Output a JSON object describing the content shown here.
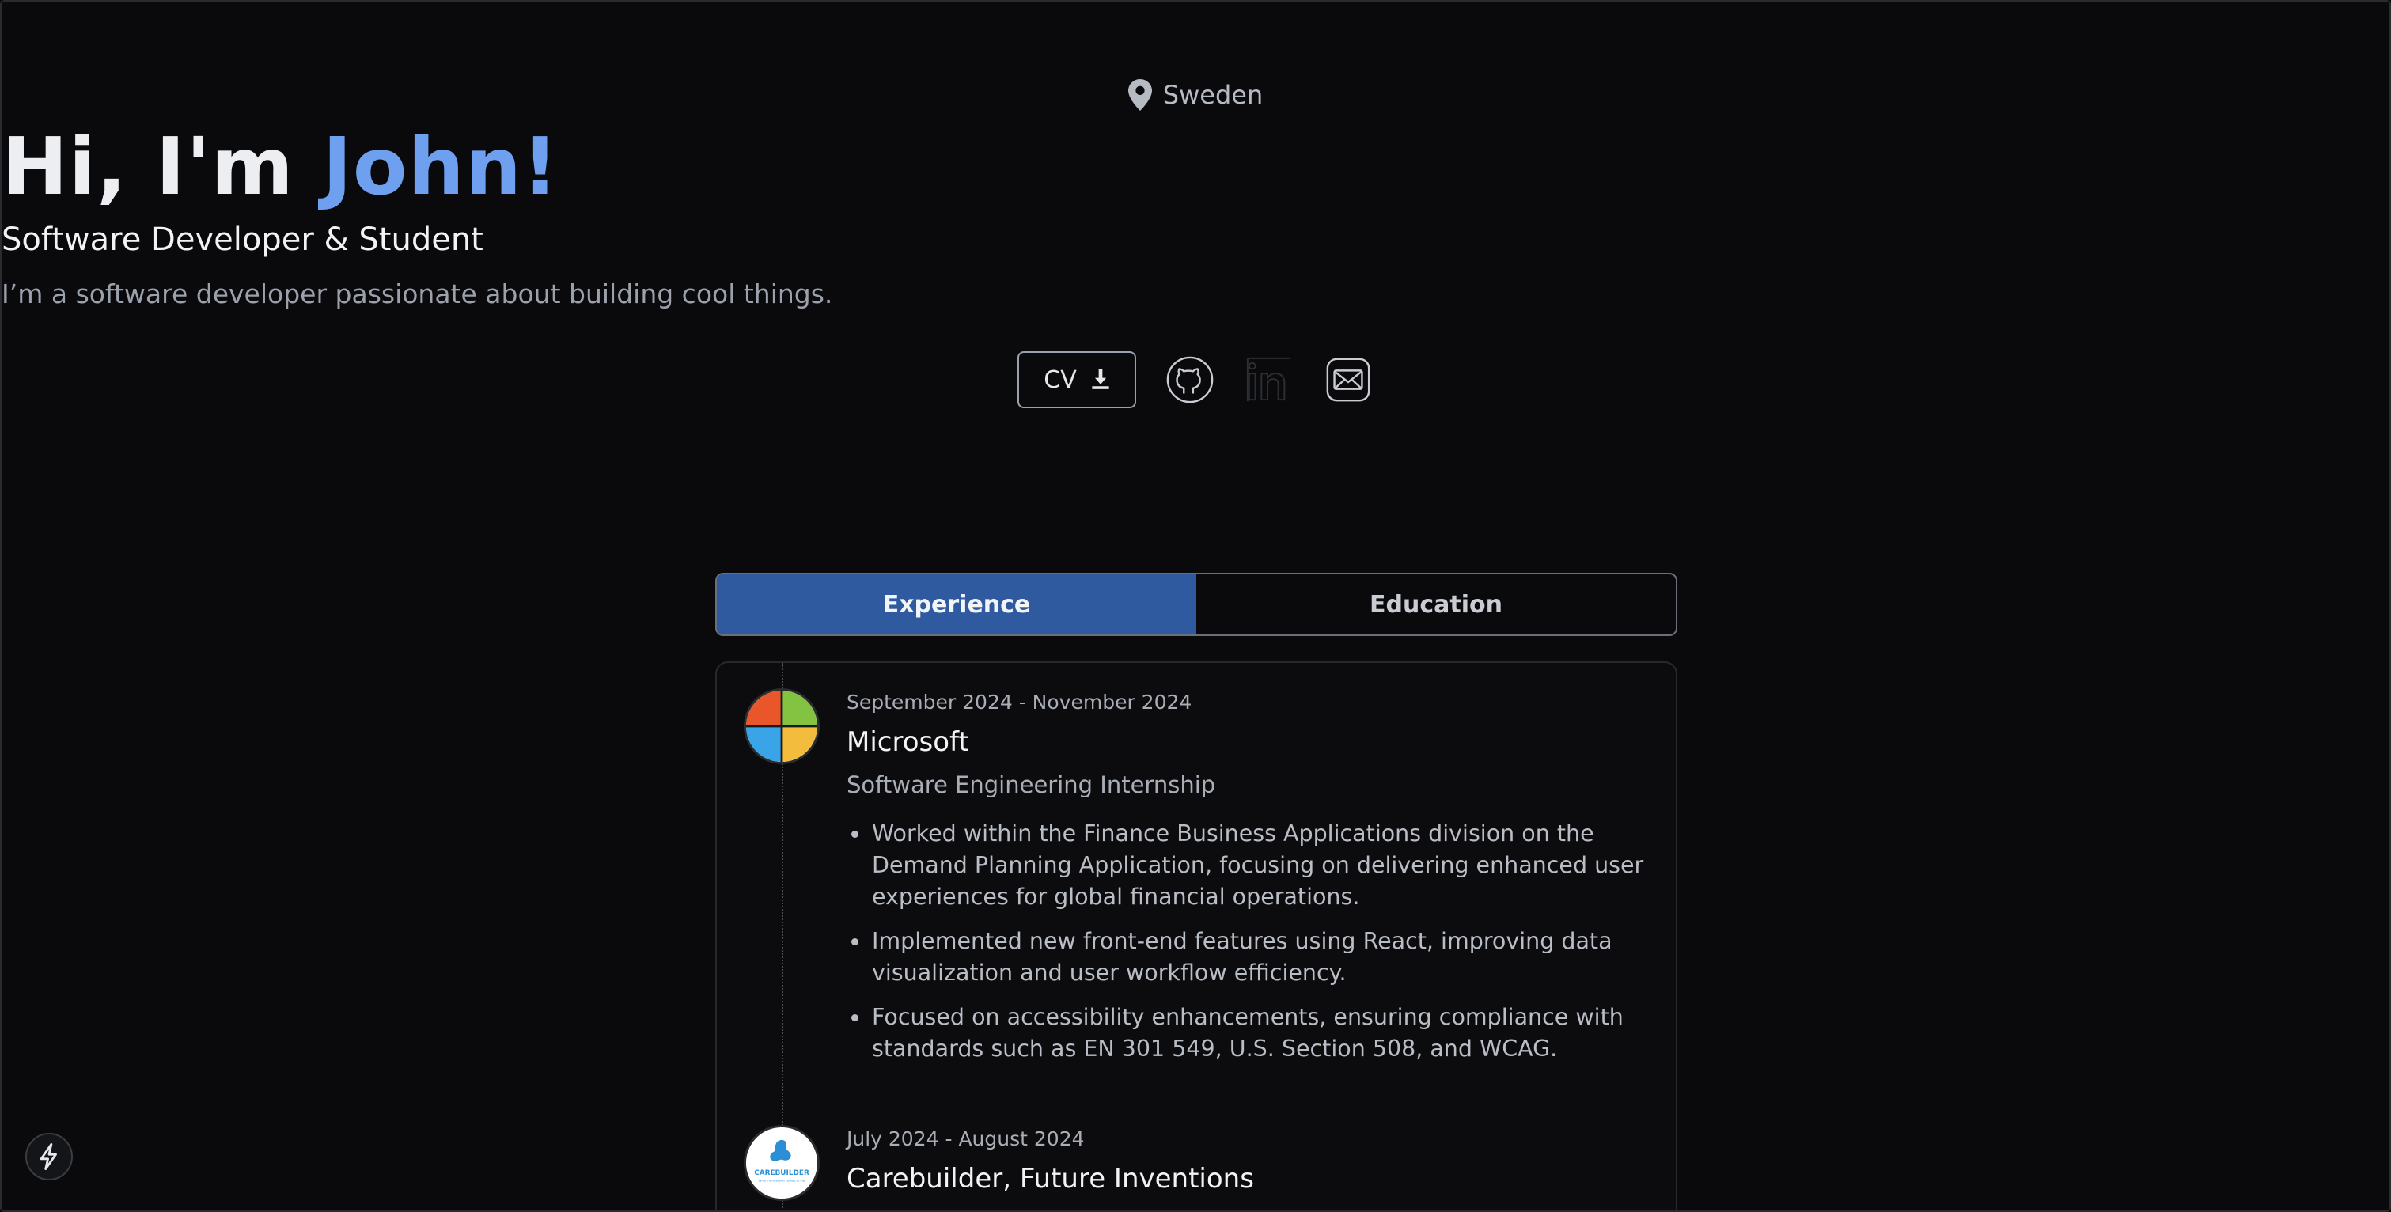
{
  "hero": {
    "location": "Sweden",
    "greeting": "Hi, I'm ",
    "name": "John!",
    "role": "Software Developer & Student",
    "tagline": "I’m a software developer passionate about building cool things.",
    "cv_label": "CV"
  },
  "social": [
    {
      "icon": "github-icon"
    },
    {
      "icon": "linkedin-icon"
    },
    {
      "icon": "mail-icon"
    }
  ],
  "tabs": [
    {
      "label": "Experience",
      "active": true
    },
    {
      "label": "Education",
      "active": false
    }
  ],
  "experience": [
    {
      "date": "September 2024 - November 2024",
      "company": "Microsoft",
      "title": "Software Engineering Internship",
      "bullets": [
        "Worked within the Finance Business Applications division on the Demand Planning Application, focusing on delivering enhanced user experiences for global financial operations.",
        "Implemented new front-end features using React, improving data visualization and user workflow efficiency.",
        "Focused on accessibility enhancements, ensuring compliance with standards such as EN 301 549, U.S. Section 508, and WCAG."
      ]
    },
    {
      "date": "July 2024 - August 2024",
      "company": "Carebuilder, Future Inventions",
      "logo_text": "CAREBUILDER",
      "logo_subtext": "Where innovation comes to life"
    }
  ],
  "colors": {
    "accent": "#6ea0ef",
    "active_tab": "#2f5aa0",
    "background": "#0a0a0c"
  }
}
